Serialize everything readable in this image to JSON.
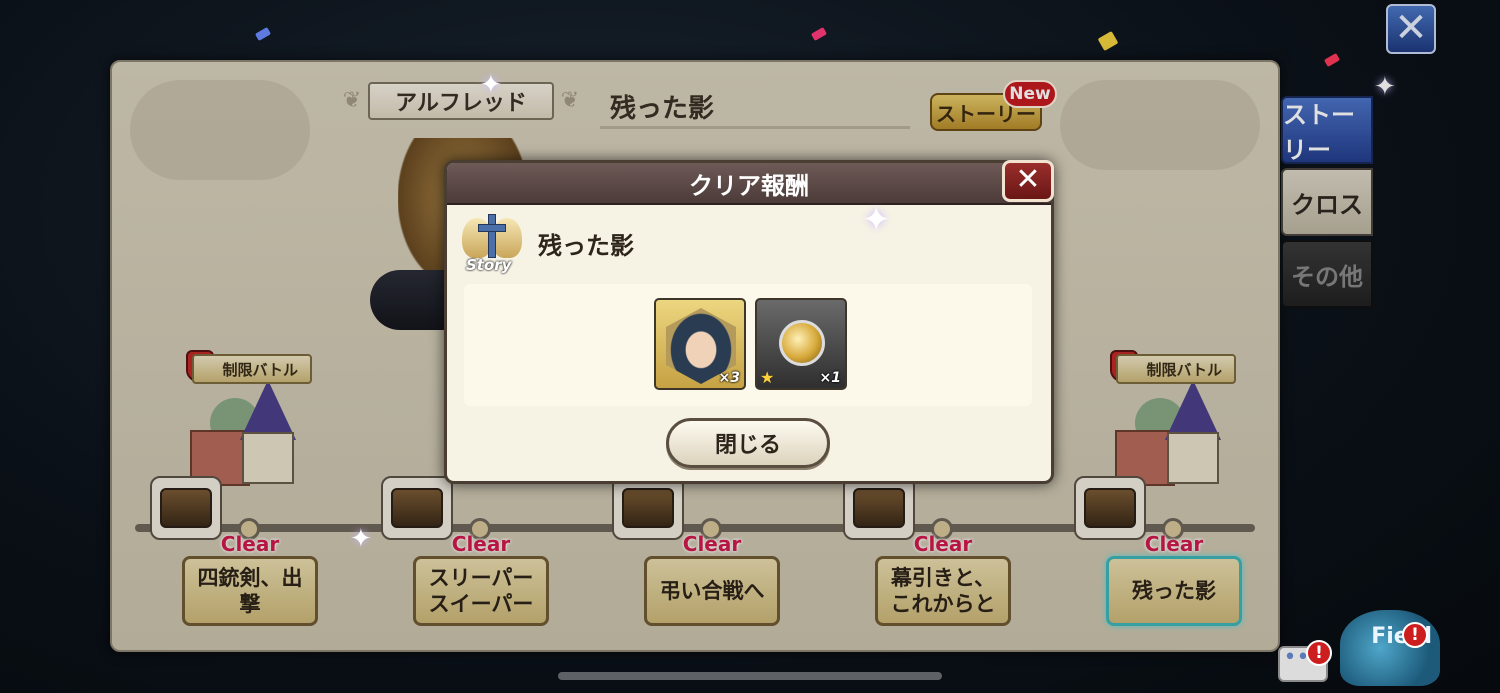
{
  "top_bar": {
    "close_label": "✕"
  },
  "panel": {
    "character_name": "アルフレッド",
    "story_title": "残った影",
    "story_button_label": "ストーリー",
    "new_badge": "New"
  },
  "side_tabs": [
    {
      "label": "ストーリー",
      "state": "active"
    },
    {
      "label": "クロス",
      "state": "normal"
    },
    {
      "label": "その他",
      "state": "disabled"
    }
  ],
  "stages": [
    {
      "name_line1": "四銃剣、出",
      "name_line2": "撃",
      "status": "Clear"
    },
    {
      "name_line1": "スリーパー",
      "name_line2": "スイーパー",
      "status": "Clear"
    },
    {
      "name_line1": "弔い合戦へ",
      "name_line2": "",
      "status": "Clear"
    },
    {
      "name_line1": "幕引きと、",
      "name_line2": "これからと",
      "status": "Clear"
    },
    {
      "name_line1": "残った影",
      "name_line2": "",
      "status": "Clear"
    }
  ],
  "limit_battle_label": "制限バトル",
  "modal": {
    "title": "クリア報酬",
    "close_label": "✕",
    "story_icon_label": "Story",
    "reward_title": "残った影",
    "items": [
      {
        "icon": "character-portrait-icon",
        "quantity": "×3"
      },
      {
        "icon": "medal-icon",
        "quantity": "×1",
        "stars": "★"
      }
    ],
    "close_button_label": "閉じる"
  },
  "widgets": {
    "chat_label": "•••",
    "alert": "!",
    "field_label": "Field"
  },
  "colors": {
    "clear_text": "#d01a4a",
    "active_tab": "#3c62b8",
    "new_badge": "#c41b1f"
  }
}
